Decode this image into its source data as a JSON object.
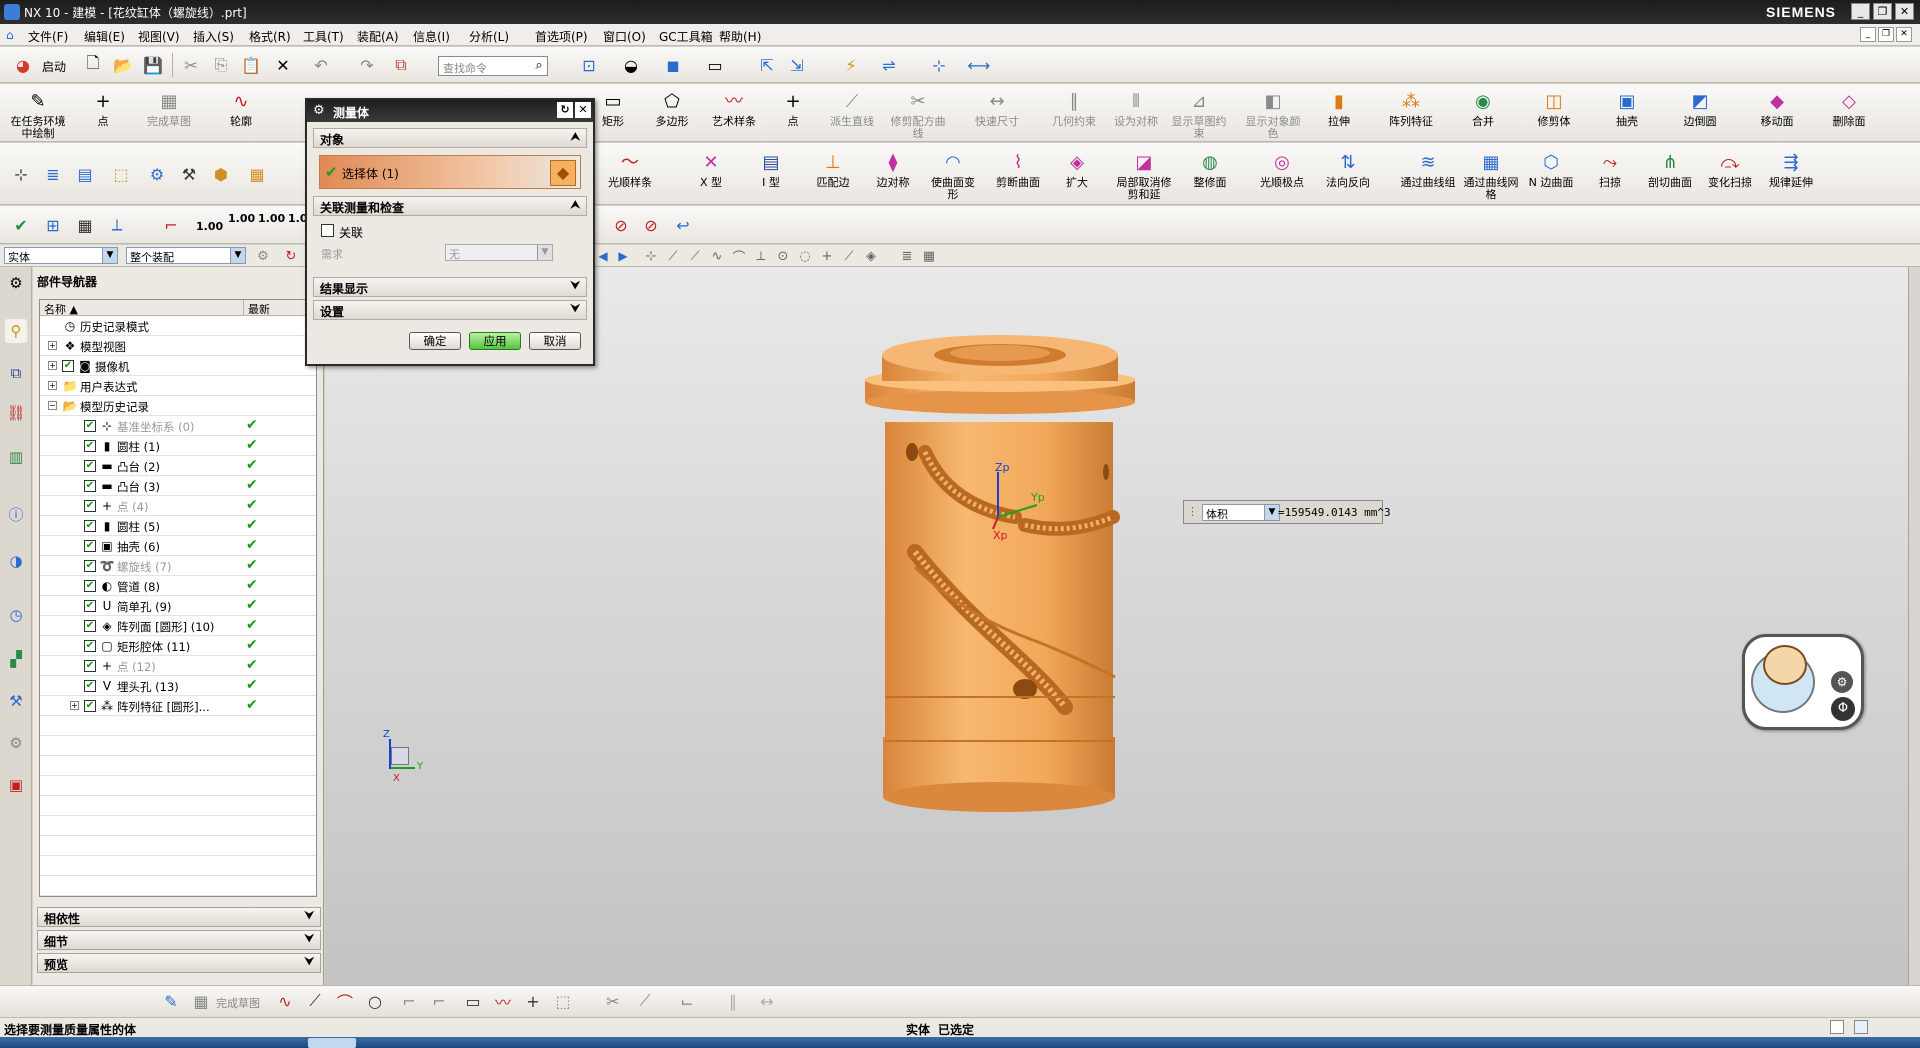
{
  "window": {
    "title": "NX 10 - 建模 - [花纹缸体（螺旋线）.prt]",
    "brand": "SIEMENS",
    "min": "_",
    "restore": "❐",
    "close": "✕"
  },
  "menu": {
    "items": [
      "文件(F)",
      "编辑(E)",
      "视图(V)",
      "插入(S)",
      "格式(R)",
      "工具(T)",
      "装配(A)",
      "信息(I)",
      "分析(L)",
      "首选项(P)",
      "窗口(O)",
      "GC工具箱",
      "帮助(H)"
    ]
  },
  "toolbar_quick": {
    "start_label": "启动",
    "search_placeholder": "查找命令"
  },
  "ribbon_row1": [
    {
      "label": "在任务环境中绘制",
      "icon": "sketch-env-icon",
      "glyph": "✎",
      "disabled": false
    },
    {
      "label": "点",
      "icon": "point-icon",
      "glyph": "+",
      "disabled": false
    },
    {
      "label": "完成草图",
      "icon": "finish-sketch-icon",
      "glyph": "▦",
      "disabled": true
    },
    {
      "label": "轮廓",
      "icon": "profile-icon",
      "glyph": "∿",
      "disabled": false
    },
    {
      "label": "矩形",
      "icon": "rectangle-icon",
      "glyph": "▭",
      "disabled": false
    },
    {
      "label": "多边形",
      "icon": "polygon-icon",
      "glyph": "⬠",
      "disabled": false
    },
    {
      "label": "艺术样条",
      "icon": "studio-spline-icon",
      "glyph": "〰",
      "disabled": false
    },
    {
      "label": "点",
      "icon": "point-icon",
      "glyph": "+",
      "disabled": false
    },
    {
      "label": "派生直线",
      "icon": "derived-line-icon",
      "glyph": "⟋",
      "disabled": true
    },
    {
      "label": "修剪配方曲线",
      "icon": "trim-recipe-icon",
      "glyph": "✂",
      "disabled": true
    },
    {
      "label": "快速尺寸",
      "icon": "rapid-dimension-icon",
      "glyph": "↔",
      "disabled": true
    },
    {
      "label": "几何约束",
      "icon": "geometric-constraint-icon",
      "glyph": "∥",
      "disabled": true
    },
    {
      "label": "设为对称",
      "icon": "symmetric-icon",
      "glyph": "⫴",
      "disabled": true
    },
    {
      "label": "显示草图约束",
      "icon": "show-constraint-icon",
      "glyph": "⊿",
      "disabled": true
    },
    {
      "label": "显示对象颜色",
      "icon": "object-color-icon",
      "glyph": "◧",
      "disabled": true
    },
    {
      "label": "拉伸",
      "icon": "extrude-icon",
      "glyph": "▮",
      "disabled": false
    },
    {
      "label": "阵列特征",
      "icon": "pattern-feature-icon",
      "glyph": "⁂",
      "disabled": false
    },
    {
      "label": "合并",
      "icon": "unite-icon",
      "glyph": "◉",
      "disabled": false
    },
    {
      "label": "修剪体",
      "icon": "trim-body-icon",
      "glyph": "◫",
      "disabled": false
    },
    {
      "label": "抽壳",
      "icon": "shell-icon",
      "glyph": "▣",
      "disabled": false
    },
    {
      "label": "边倒圆",
      "icon": "edge-blend-icon",
      "glyph": "◩",
      "disabled": false
    },
    {
      "label": "移动面",
      "icon": "move-face-icon",
      "glyph": "◆",
      "disabled": false
    },
    {
      "label": "删除面",
      "icon": "delete-face-icon",
      "glyph": "◇",
      "disabled": false
    }
  ],
  "ribbon_row2": [
    {
      "label": "光顺样条",
      "icon": "smooth-spline-icon",
      "glyph": "〜"
    },
    {
      "label": "X 型",
      "icon": "x-form-icon",
      "glyph": "✕"
    },
    {
      "label": "I 型",
      "icon": "i-form-icon",
      "glyph": "▤"
    },
    {
      "label": "匹配边",
      "icon": "match-edge-icon",
      "glyph": "⊥"
    },
    {
      "label": "边对称",
      "icon": "edge-symmetry-icon",
      "glyph": "⧫"
    },
    {
      "label": "使曲面变形",
      "icon": "deform-surface-icon",
      "glyph": "◠"
    },
    {
      "label": "剪断曲面",
      "icon": "divide-surface-icon",
      "glyph": "⌇"
    },
    {
      "label": "扩大",
      "icon": "enlarge-icon",
      "glyph": "◈"
    },
    {
      "label": "局部取消修剪和延",
      "icon": "local-untrim-icon",
      "glyph": "◪"
    },
    {
      "label": "整修面",
      "icon": "refit-face-icon",
      "glyph": "◍"
    },
    {
      "label": "光顺极点",
      "icon": "smooth-poles-icon",
      "glyph": "◎"
    },
    {
      "label": "法向反向",
      "icon": "reverse-normal-icon",
      "glyph": "⇅"
    },
    {
      "label": "通过曲线组",
      "icon": "through-curves-icon",
      "glyph": "≋"
    },
    {
      "label": "通过曲线网格",
      "icon": "curve-mesh-icon",
      "glyph": "▦"
    },
    {
      "label": "N 边曲面",
      "icon": "n-sided-surface-icon",
      "glyph": "⬡"
    },
    {
      "label": "扫掠",
      "icon": "swept-icon",
      "glyph": "⤳"
    },
    {
      "label": "剖切曲面",
      "icon": "section-surface-icon",
      "glyph": "⋔"
    },
    {
      "label": "变化扫掠",
      "icon": "variational-sweep-icon",
      "glyph": "⤼"
    },
    {
      "label": "规律延伸",
      "icon": "law-extension-icon",
      "glyph": "⇶"
    }
  ],
  "row3": {
    "dims": [
      "1.00",
      "1.00",
      "1.00",
      "1.00"
    ]
  },
  "filter": {
    "type_value": "实体",
    "scope_value": "整个装配"
  },
  "navigator": {
    "title": "部件导航器",
    "col_name": "名称",
    "col_latest": "最新",
    "rows": [
      {
        "label": "历史记录模式",
        "indent": 0,
        "expander": "",
        "checkbox": false,
        "icon": "clock-icon",
        "glyph": "◷",
        "dim": false,
        "latest": ""
      },
      {
        "label": "模型视图",
        "indent": 0,
        "expander": "+",
        "checkbox": false,
        "icon": "model-views-icon",
        "glyph": "❖",
        "dim": false,
        "latest": ""
      },
      {
        "label": "摄像机",
        "indent": 0,
        "expander": "+",
        "checkbox": true,
        "icon": "camera-icon",
        "glyph": "◙",
        "dim": false,
        "latest": ""
      },
      {
        "label": "用户表达式",
        "indent": 0,
        "expander": "+",
        "checkbox": false,
        "icon": "folder-icon",
        "glyph": "📁",
        "dim": false,
        "latest": ""
      },
      {
        "label": "模型历史记录",
        "indent": 0,
        "expander": "−",
        "checkbox": false,
        "icon": "folder-icon",
        "glyph": "📂",
        "dim": false,
        "latest": ""
      },
      {
        "label": "基准坐标系 (0)",
        "indent": 1,
        "expander": "",
        "checkbox": true,
        "icon": "datum-csys-icon",
        "glyph": "⊹",
        "dim": true,
        "latest": "✔"
      },
      {
        "label": "圆柱 (1)",
        "indent": 1,
        "expander": "",
        "checkbox": true,
        "icon": "cylinder-icon",
        "glyph": "▮",
        "dim": false,
        "latest": "✔"
      },
      {
        "label": "凸台 (2)",
        "indent": 1,
        "expander": "",
        "checkbox": true,
        "icon": "boss-icon",
        "glyph": "▬",
        "dim": false,
        "latest": "✔"
      },
      {
        "label": "凸台 (3)",
        "indent": 1,
        "expander": "",
        "checkbox": true,
        "icon": "boss-icon",
        "glyph": "▬",
        "dim": false,
        "latest": "✔"
      },
      {
        "label": "点 (4)",
        "indent": 1,
        "expander": "",
        "checkbox": true,
        "icon": "point-icon",
        "glyph": "+",
        "dim": true,
        "latest": "✔"
      },
      {
        "label": "圆柱 (5)",
        "indent": 1,
        "expander": "",
        "checkbox": true,
        "icon": "cylinder-icon",
        "glyph": "▮",
        "dim": false,
        "latest": "✔"
      },
      {
        "label": "抽壳 (6)",
        "indent": 1,
        "expander": "",
        "checkbox": true,
        "icon": "shell-icon",
        "glyph": "▣",
        "dim": false,
        "latest": "✔"
      },
      {
        "label": "螺旋线 (7)",
        "indent": 1,
        "expander": "",
        "checkbox": true,
        "icon": "helix-icon",
        "glyph": "➰",
        "dim": true,
        "latest": "✔"
      },
      {
        "label": "管道 (8)",
        "indent": 1,
        "expander": "",
        "checkbox": true,
        "icon": "tube-icon",
        "glyph": "◐",
        "dim": false,
        "latest": "✔"
      },
      {
        "label": "简单孔 (9)",
        "indent": 1,
        "expander": "",
        "checkbox": true,
        "icon": "hole-icon",
        "glyph": "U",
        "dim": false,
        "latest": "✔"
      },
      {
        "label": "阵列面 [圆形] (10)",
        "indent": 1,
        "expander": "",
        "checkbox": true,
        "icon": "pattern-face-icon",
        "glyph": "◈",
        "dim": false,
        "latest": "✔"
      },
      {
        "label": "矩形腔体 (11)",
        "indent": 1,
        "expander": "",
        "checkbox": true,
        "icon": "pocket-icon",
        "glyph": "▢",
        "dim": false,
        "latest": "✔"
      },
      {
        "label": "点 (12)",
        "indent": 1,
        "expander": "",
        "checkbox": true,
        "icon": "point-icon",
        "glyph": "+",
        "dim": true,
        "latest": "✔"
      },
      {
        "label": "埋头孔 (13)",
        "indent": 1,
        "expander": "",
        "checkbox": true,
        "icon": "countersink-icon",
        "glyph": "V",
        "dim": false,
        "latest": "✔"
      },
      {
        "label": "阵列特征 [圆形]...",
        "indent": 1,
        "expander": "+",
        "checkbox": true,
        "icon": "pattern-feature-icon",
        "glyph": "⁂",
        "dim": false,
        "latest": "✔"
      }
    ],
    "panels": [
      "相依性",
      "细节",
      "预览"
    ]
  },
  "dialog": {
    "title": "测量体",
    "section_object": "对象",
    "select_label": "选择体 (1)",
    "section_assoc": "关联测量和检查",
    "assoc_label": "关联",
    "need_label": "需求",
    "need_value": "无",
    "section_result": "结果显示",
    "section_settings": "设置",
    "ok": "确定",
    "apply": "应用",
    "cancel": "取消"
  },
  "measure_readout": {
    "quantity": "体积",
    "value": "=159549.0143 mm^3"
  },
  "triad": {
    "zp": "Zp",
    "yp": "Yp",
    "xp": "Xp"
  },
  "view_triad": {
    "z": "Z",
    "y": "Y",
    "x": "X"
  },
  "bottom_toolbar": {
    "finish_sketch": "完成草图"
  },
  "status": {
    "prompt": "选择要测量质量属性的体",
    "right_type": "实体",
    "right_state": "已选定"
  },
  "colors": {
    "part": "#f0a456",
    "part_dark": "#c97c33",
    "accent_green": "#3cb43c"
  }
}
